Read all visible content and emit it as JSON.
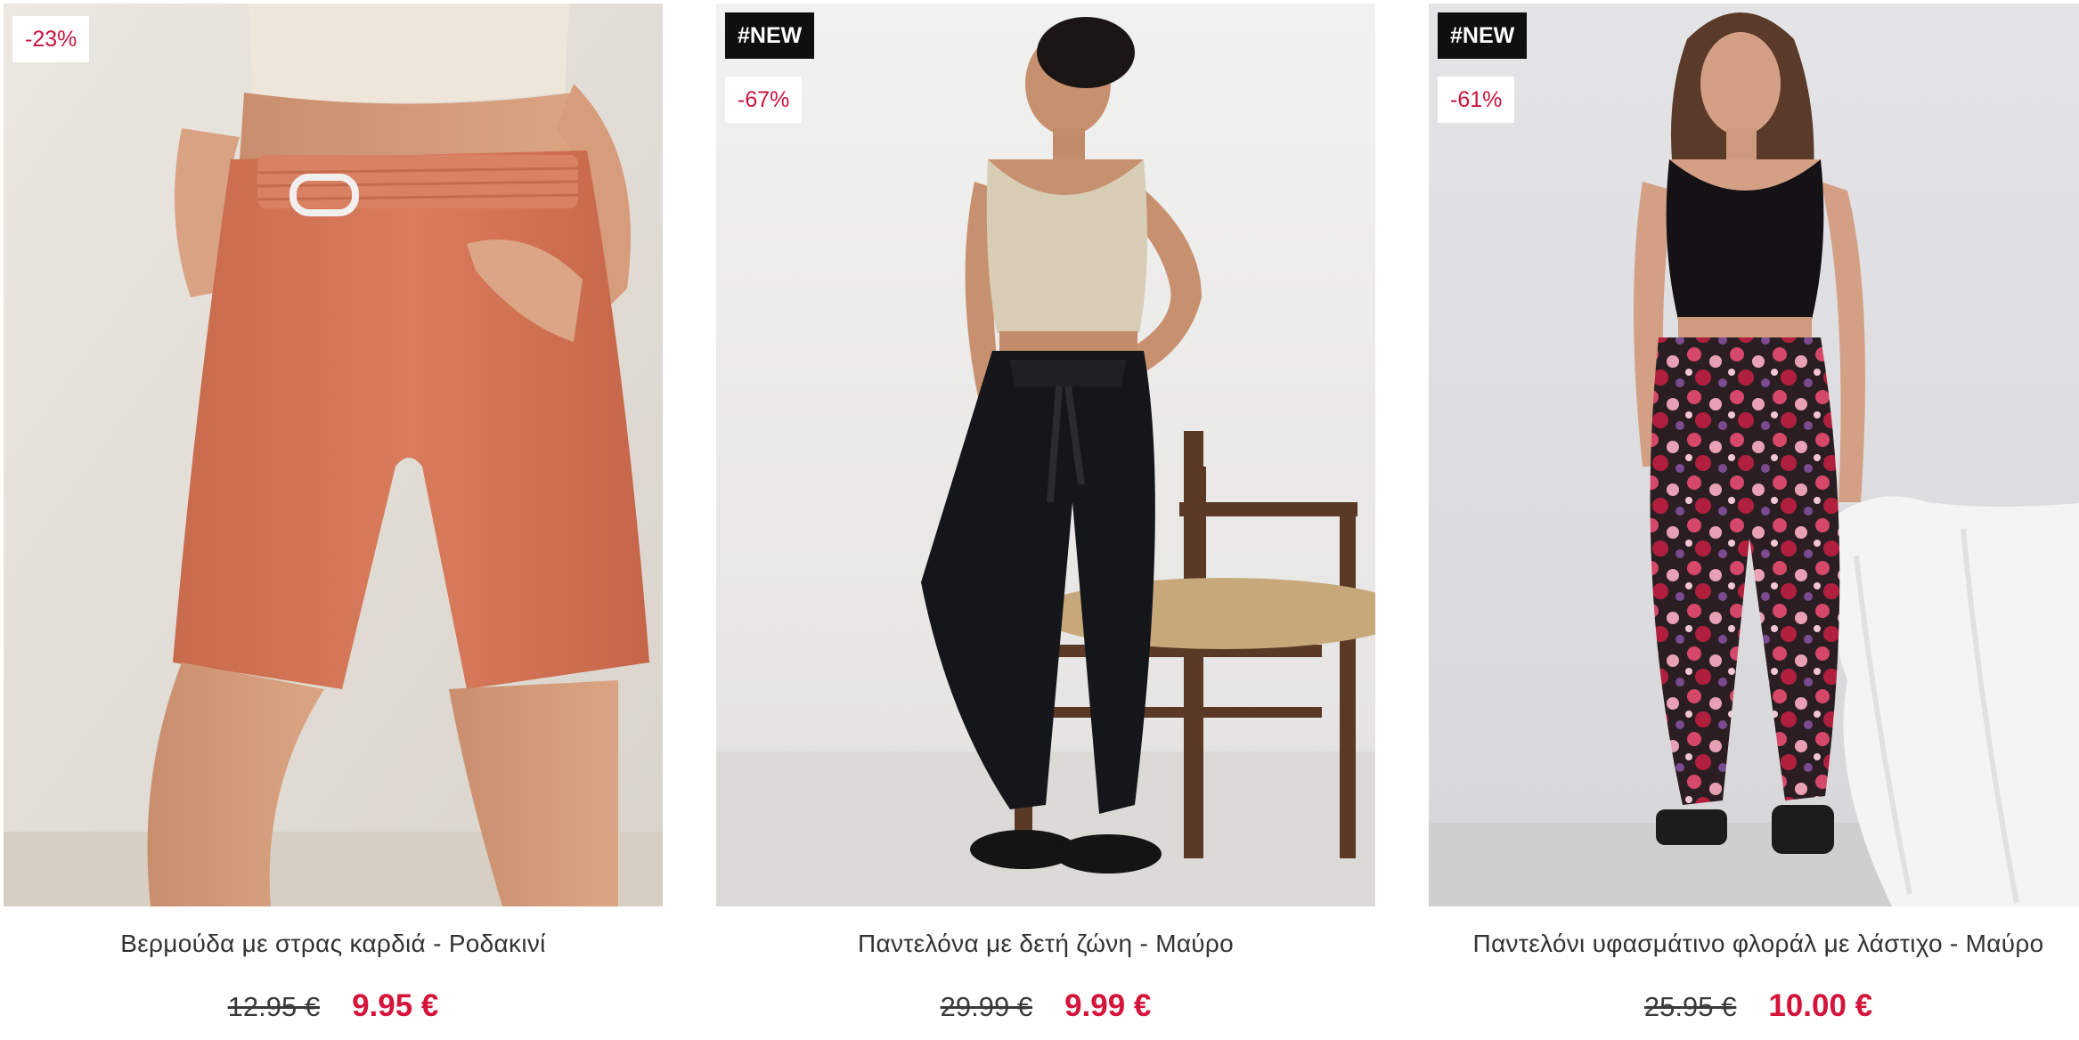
{
  "products": [
    {
      "badge_new": "",
      "discount": "-23%",
      "title": "Βερμούδα με στρας καρδιά - Ροδακινί",
      "old_price": "12.95 €",
      "new_price": "9.95 €",
      "image_icon": "product-photo-peach-shorts"
    },
    {
      "badge_new": "#NEW",
      "discount": "-67%",
      "title": "Παντελόνα με δετή ζώνη - Μαύρο",
      "old_price": "29.99 €",
      "new_price": "9.99 €",
      "image_icon": "product-photo-black-trousers"
    },
    {
      "badge_new": "#NEW",
      "discount": "-61%",
      "title": "Παντελόνι υφασμάτινο φλοράλ με λάστιχο - Μαύρο",
      "old_price": "25.95 €",
      "new_price": "10.00 €",
      "image_icon": "product-photo-floral-trousers"
    }
  ],
  "colors": {
    "discount_text": "#c8143c",
    "price_accent": "#d4143a",
    "new_badge_bg": "#0f0f0f"
  }
}
